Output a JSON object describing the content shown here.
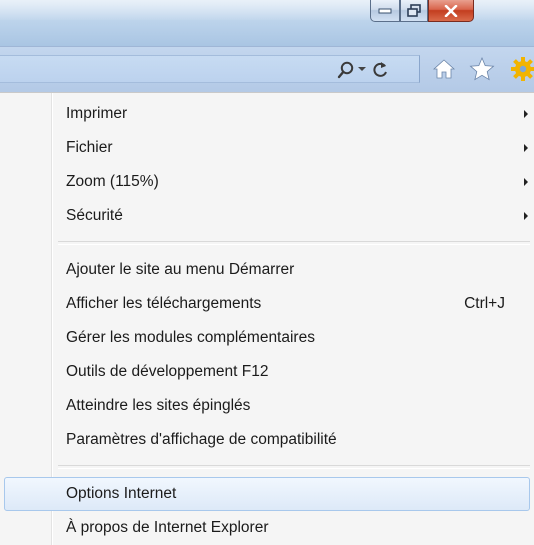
{
  "window": {
    "caption_icons": [
      "minimize-icon",
      "restore-icon",
      "close-icon"
    ]
  },
  "toolbar": {
    "icons": [
      "search-icon",
      "dropdown-arrow-icon",
      "refresh-icon",
      "home-icon",
      "favorites-star-icon",
      "tools-gear-icon"
    ]
  },
  "menu": {
    "group1": [
      {
        "label": "Imprimer",
        "submenu": true
      },
      {
        "label": "Fichier",
        "submenu": true
      },
      {
        "label": "Zoom (115%)",
        "submenu": true
      },
      {
        "label": "Sécurité",
        "submenu": true
      }
    ],
    "group2": [
      {
        "label": "Ajouter le site au menu Démarrer"
      },
      {
        "label": "Afficher les téléchargements",
        "shortcut": "Ctrl+J"
      },
      {
        "label": "Gérer les modules complémentaires"
      },
      {
        "label": "Outils de développement F12"
      },
      {
        "label": "Atteindre les sites épinglés"
      },
      {
        "label": "Paramètres d'affichage de compatibilité"
      }
    ],
    "group3": [
      {
        "label": "Options Internet",
        "highlighted": true
      },
      {
        "label": "À propos de Internet Explorer"
      }
    ]
  },
  "colors": {
    "titlebar": "#b9d1ea",
    "close_button": "#c33d1f",
    "menu_background": "#f5f5f5",
    "hover_border": "#a8c8ec",
    "gear_accent": "#f2b400"
  }
}
